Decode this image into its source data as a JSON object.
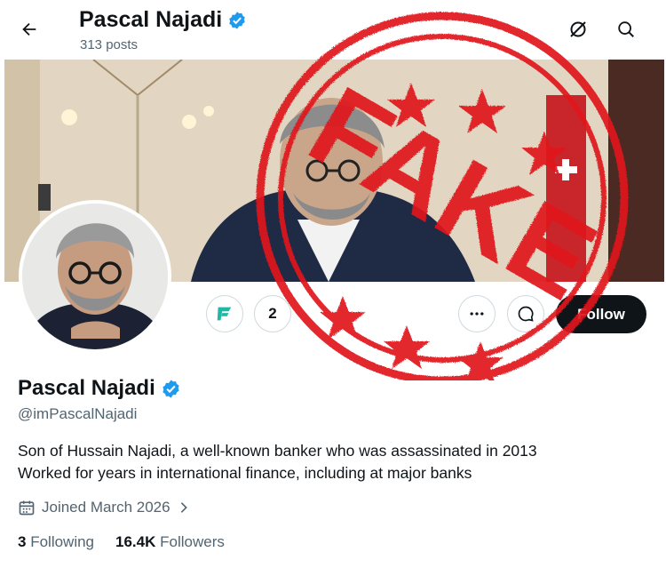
{
  "header": {
    "name": "Pascal Najadi",
    "posts_count": "313 posts"
  },
  "actions": {
    "second_circle_label": "2",
    "follow_label": "Follow"
  },
  "profile": {
    "name": "Pascal Najadi",
    "handle": "@imPascalNajadi",
    "bio_line1": "Son of Hussain Najadi, a well-known banker who was assassinated in 2013",
    "bio_line2": "Worked for years in international finance, including at major banks",
    "joined": "Joined March 2026",
    "following_count": "3",
    "following_label": "Following",
    "followers_count": "16.4K",
    "followers_label": "Followers"
  },
  "overlay": {
    "stamp_text": "FAKE"
  },
  "icons": {
    "back": "arrow-left-icon",
    "grok": "grok-icon",
    "search": "search-icon",
    "verified": "verified-badge-icon",
    "more": "more-icon",
    "message": "message-icon",
    "calendar": "calendar-icon",
    "chevron": "chevron-right-icon"
  },
  "colors": {
    "verified_blue": "#1d9bf0",
    "stamp_red": "#e0141e",
    "text_primary": "#0f1419",
    "text_secondary": "#536471",
    "follow_bg": "#0f1419"
  }
}
